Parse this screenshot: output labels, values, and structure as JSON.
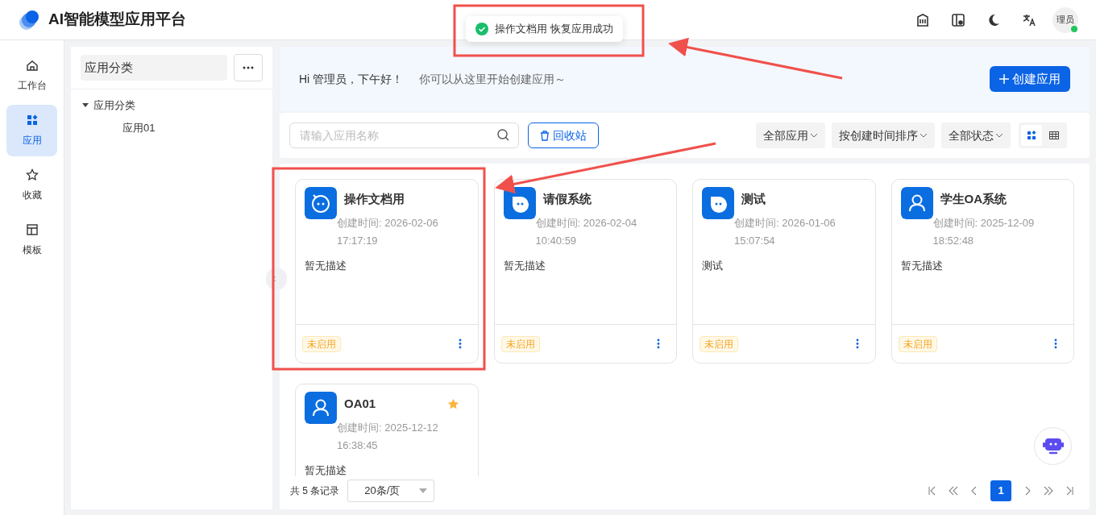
{
  "header": {
    "title": "AI智能模型应用平台",
    "avatar": "理员",
    "online": true
  },
  "toast": {
    "message": "操作文档用 恢复应用成功"
  },
  "nav": [
    {
      "label": "工作台",
      "kind": "home",
      "selected": false
    },
    {
      "label": "应用",
      "kind": "apps",
      "selected": true
    },
    {
      "label": "收藏",
      "kind": "star",
      "selected": false
    },
    {
      "label": "模板",
      "kind": "layout",
      "selected": false
    }
  ],
  "category_panel": {
    "title": "应用分类",
    "tree": [
      {
        "label": "应用分类",
        "expanded": true,
        "children": [
          {
            "label": "应用01"
          }
        ]
      }
    ]
  },
  "banner": {
    "greeting": "Hi 管理员，下午好！",
    "hint": "你可以从这里开始创建应用～",
    "create_button": "创建应用"
  },
  "toolbar": {
    "search": {
      "placeholder": "请输入应用名称"
    },
    "recycle_button": "回收站",
    "filters": [
      "全部应用",
      "按创建时间排序",
      "全部状态"
    ],
    "views": [
      {
        "kind": "card",
        "selected": true
      },
      {
        "kind": "table",
        "selected": false
      }
    ]
  },
  "apps": [
    {
      "name": "操作文档用",
      "kind": "bot-outline",
      "created": "创建时间: 2026-02-06 17:17:19",
      "description": "暂无描述",
      "status": "未启用",
      "starred": false
    },
    {
      "name": "请假系统",
      "kind": "bot",
      "created": "创建时间: 2026-02-04 10:40:59",
      "description": "暂无描述",
      "status": "未启用",
      "starred": false
    },
    {
      "name": "测试",
      "kind": "bot",
      "created": "创建时间: 2026-01-06 15:07:54",
      "description": "测试",
      "status": "未启用",
      "starred": false
    },
    {
      "name": "学生OA系统",
      "kind": "user",
      "created": "创建时间: 2025-12-09 18:52:48",
      "description": "暂无描述",
      "status": "未启用",
      "starred": false
    },
    {
      "name": "OA01",
      "kind": "user",
      "created": "创建时间: 2025-12-12 16:38:45",
      "description": "暂无描述",
      "starred": true
    }
  ],
  "pagination": {
    "total": "共 5 条记录",
    "page_size": "20条/页",
    "pages": [
      {
        "label": "1",
        "selected": true
      }
    ]
  }
}
